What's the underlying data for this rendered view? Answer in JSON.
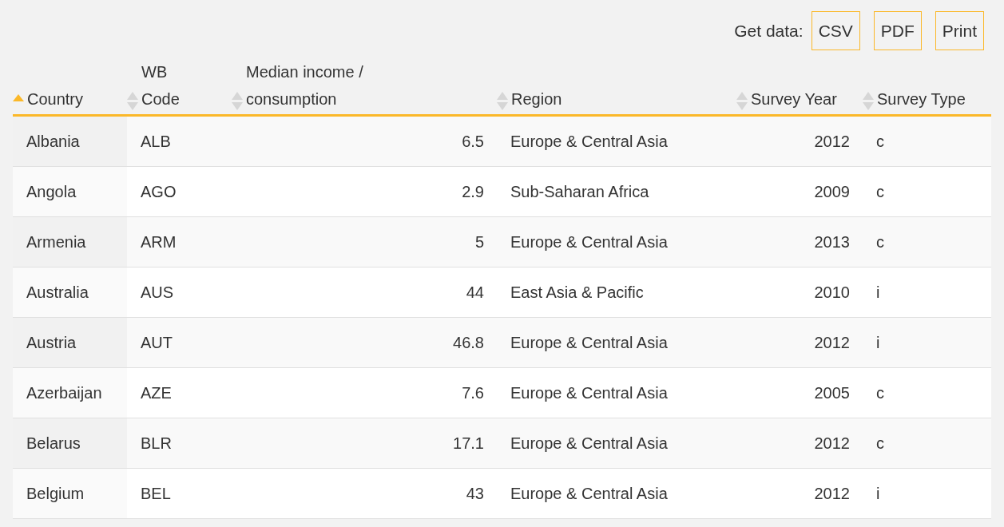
{
  "get_data": {
    "label": "Get data:",
    "buttons": [
      "CSV",
      "PDF",
      "Print"
    ]
  },
  "table": {
    "columns": [
      {
        "label": "Country",
        "sorted_ascending": true
      },
      {
        "label": "WB Code",
        "sorted_ascending": false
      },
      {
        "label": "Median income / consumption",
        "sorted_ascending": false
      },
      {
        "label": "Region",
        "sorted_ascending": false
      },
      {
        "label": "Survey Year",
        "sorted_ascending": false
      },
      {
        "label": "Survey Type",
        "sorted_ascending": false
      }
    ],
    "rows": [
      [
        "Albania",
        "ALB",
        "6.5",
        "Europe & Central Asia",
        "2012",
        "c"
      ],
      [
        "Angola",
        "AGO",
        "2.9",
        "Sub-Saharan Africa",
        "2009",
        "c"
      ],
      [
        "Armenia",
        "ARM",
        "5",
        "Europe & Central Asia",
        "2013",
        "c"
      ],
      [
        "Australia",
        "AUS",
        "44",
        "East Asia & Pacific",
        "2010",
        "i"
      ],
      [
        "Austria",
        "AUT",
        "46.8",
        "Europe & Central Asia",
        "2012",
        "i"
      ],
      [
        "Azerbaijan",
        "AZE",
        "7.6",
        "Europe & Central Asia",
        "2005",
        "c"
      ],
      [
        "Belarus",
        "BLR",
        "17.1",
        "Europe & Central Asia",
        "2012",
        "c"
      ],
      [
        "Belgium",
        "BEL",
        "43",
        "Europe & Central Asia",
        "2012",
        "i"
      ]
    ]
  }
}
